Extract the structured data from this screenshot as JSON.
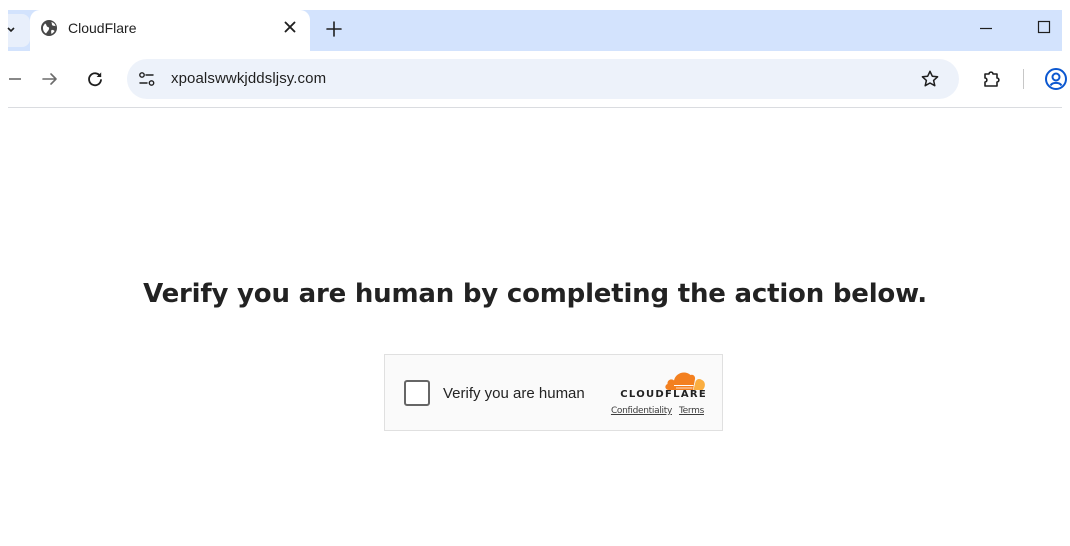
{
  "browser": {
    "tab": {
      "title": "CloudFlare",
      "favicon": "globe-icon"
    },
    "new_tab_label": "+",
    "address_bar": {
      "url": "xpoalswwkjddsljsy.com"
    },
    "window_controls": [
      "minimize-icon",
      "maximize-icon"
    ]
  },
  "page": {
    "heading": "Verify you are human by completing the action below.",
    "challenge": {
      "checkbox_checked": false,
      "label": "Verify you are human",
      "brand": "CLOUDFLARE",
      "links": {
        "confidentiality": "Confidentiality",
        "terms": "Terms"
      }
    }
  },
  "colors": {
    "tabstrip": "#d3e3fd",
    "omnibox": "#edf2fa",
    "cloudflare_orange": "#f38020",
    "cloudflare_light_orange": "#faae40",
    "profile_blue": "#0b57d0"
  }
}
